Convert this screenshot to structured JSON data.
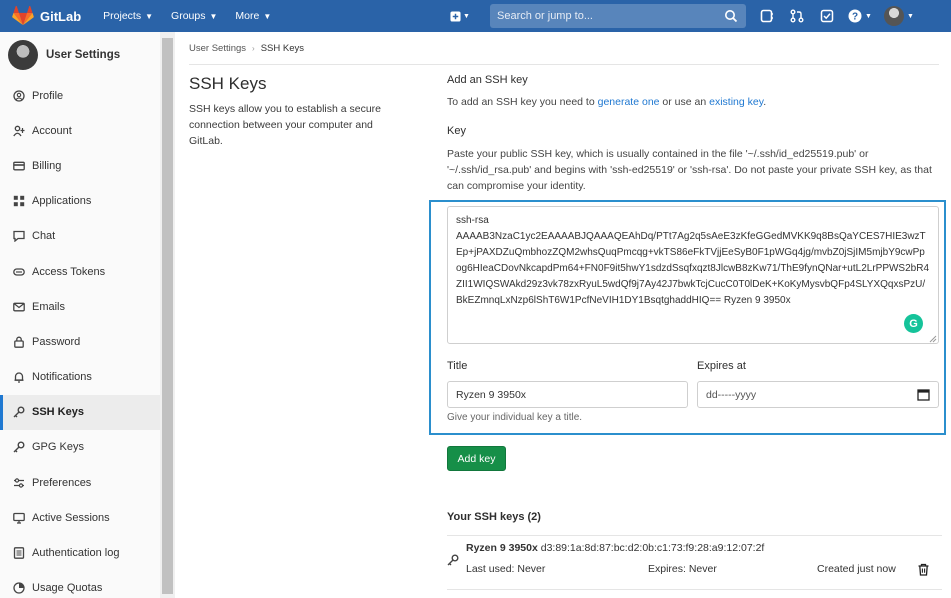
{
  "navbar": {
    "brand": "GitLab",
    "menus": [
      {
        "label": "Projects"
      },
      {
        "label": "Groups"
      },
      {
        "label": "More"
      }
    ],
    "search_placeholder": "Search or jump to...",
    "brand_color": "#2a63a8"
  },
  "sidebar": {
    "title": "User Settings",
    "items": [
      {
        "label": "Profile",
        "icon": "profile-icon",
        "active": false
      },
      {
        "label": "Account",
        "icon": "account-icon",
        "active": false
      },
      {
        "label": "Billing",
        "icon": "credit-card-icon",
        "active": false
      },
      {
        "label": "Applications",
        "icon": "applications-icon",
        "active": false
      },
      {
        "label": "Chat",
        "icon": "chat-icon",
        "active": false
      },
      {
        "label": "Access Tokens",
        "icon": "token-icon",
        "active": false
      },
      {
        "label": "Emails",
        "icon": "mail-icon",
        "active": false
      },
      {
        "label": "Password",
        "icon": "lock-icon",
        "active": false
      },
      {
        "label": "Notifications",
        "icon": "bell-icon",
        "active": false
      },
      {
        "label": "SSH Keys",
        "icon": "key-icon",
        "active": true
      },
      {
        "label": "GPG Keys",
        "icon": "key-icon",
        "active": false
      },
      {
        "label": "Preferences",
        "icon": "preferences-icon",
        "active": false
      },
      {
        "label": "Active Sessions",
        "icon": "monitor-icon",
        "active": false
      },
      {
        "label": "Authentication log",
        "icon": "log-icon",
        "active": false
      },
      {
        "label": "Usage Quotas",
        "icon": "quota-icon",
        "active": false
      }
    ]
  },
  "breadcrumb": {
    "parent": "User Settings",
    "current": "SSH Keys"
  },
  "page": {
    "title": "SSH Keys",
    "description": "SSH keys allow you to establish a secure connection between your computer and GitLab."
  },
  "form": {
    "add_heading": "Add an SSH key",
    "add_text_pre": "To add an SSH key you need to ",
    "generate_link": "generate one",
    "add_text_mid": " or use an ",
    "existing_link": "existing key",
    "add_text_post": ".",
    "key_label": "Key",
    "key_help": "Paste your public SSH key, which is usually contained in the file '~/.ssh/id_ed25519.pub' or '~/.ssh/id_rsa.pub' and begins with 'ssh-ed25519' or 'ssh-rsa'. Do not paste your private SSH key, as that can compromise your identity.",
    "key_value_line1": "ssh-rsa",
    "key_value_line2": "AAAAB3NzaC1yc2EAAAABJQAAAQEAhDq/PTt7Ag2q5sAeE3zKfeGGedMVKK9q8BsQaYCES7HIE3wzTEp+jPAXDZuQmbhozZQM2whsQuqPmcqg+vkTS86eFkTVjjEeSyB0F1pWGq4jg/mvbZ0jSjIM5mjbY9cwPpog6HIeaCDovNkcapdPm64+FN0F9it5hwY1sdzdSsqfxqzt8JlcwB8zKw71/ThE9fynQNar+utL2LrPPWS2bR4ZII1WIQSWAkd29z3vk78zxRyuL5wdQf9j7Ay42J7bwkTcjCucC0T0lDeK+KoKyMysvbQFp4SLYXQqxsPzU/BkEZmnqLxNzp6lShT6W1PcfNeVIH1DY1BsqtghaddHIQ== Ryzen 9 3950x",
    "title_label": "Title",
    "title_value": "Ryzen 9 3950x",
    "expires_label": "Expires at",
    "expires_placeholder": "dd-----yyyy",
    "title_hint": "Give your individual key a title.",
    "add_button": "Add key"
  },
  "keys": {
    "heading": "Your SSH keys (2)",
    "list": [
      {
        "name": "Ryzen 9 3950x",
        "fingerprint": "d3:89:1a:8d:87:bc:d2:0b:c1:73:f9:28:a9:12:07:2f",
        "last_used": "Last used: Never",
        "expires": "Expires: Never",
        "created": "Created just now"
      }
    ]
  }
}
